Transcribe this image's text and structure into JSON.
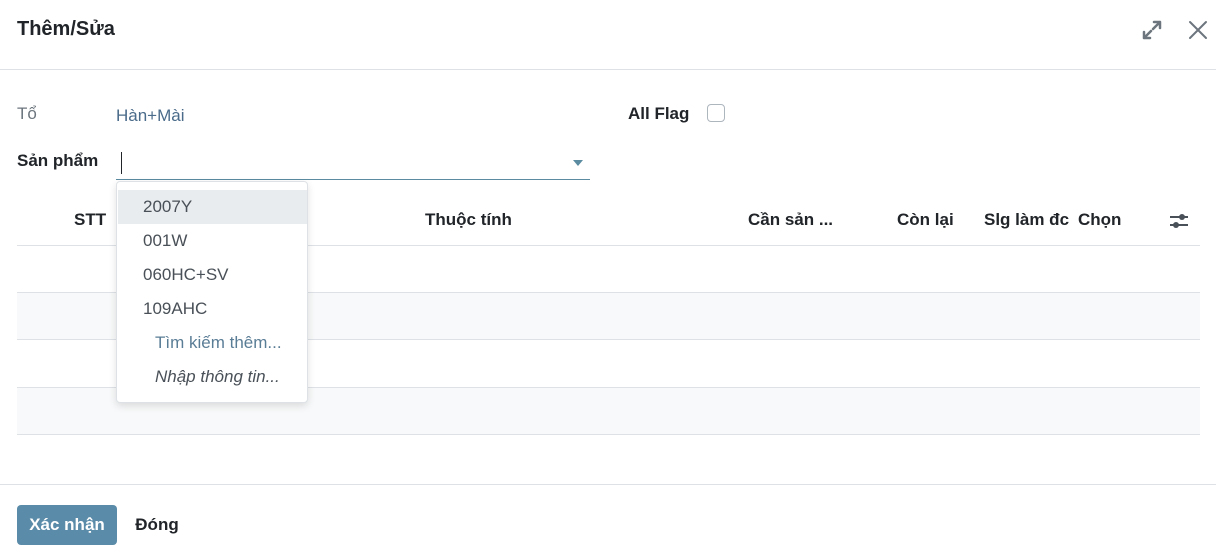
{
  "dialog": {
    "title": "Thêm/Sửa"
  },
  "icons": {
    "expand": "expand-icon",
    "close": "close-icon",
    "settings": "settings-sliders-icon",
    "dropdown": "caret-down-icon"
  },
  "form": {
    "to_label": "Tổ",
    "to_value": "Hàn+Mài",
    "all_flag_label": "All Flag",
    "all_flag_checked": false,
    "product_label": "Sản phẩm",
    "product_value": ""
  },
  "table": {
    "columns": [
      "STT",
      "Thuộc tính",
      "Cần sản ...",
      "Còn lại",
      "Slg làm đc",
      "Chọn"
    ]
  },
  "dropdown": {
    "options": [
      "2007Y",
      "001W",
      "060HC+SV",
      "109AHC"
    ],
    "search_more": "Tìm kiếm thêm...",
    "create_edit": "Nhập thông tin..."
  },
  "footer": {
    "confirm_label": "Xác nhận",
    "close_label": "Đóng"
  },
  "colors": {
    "accent": "#5a8ba8",
    "link": "#5a7d96",
    "border": "#dee2e6"
  }
}
